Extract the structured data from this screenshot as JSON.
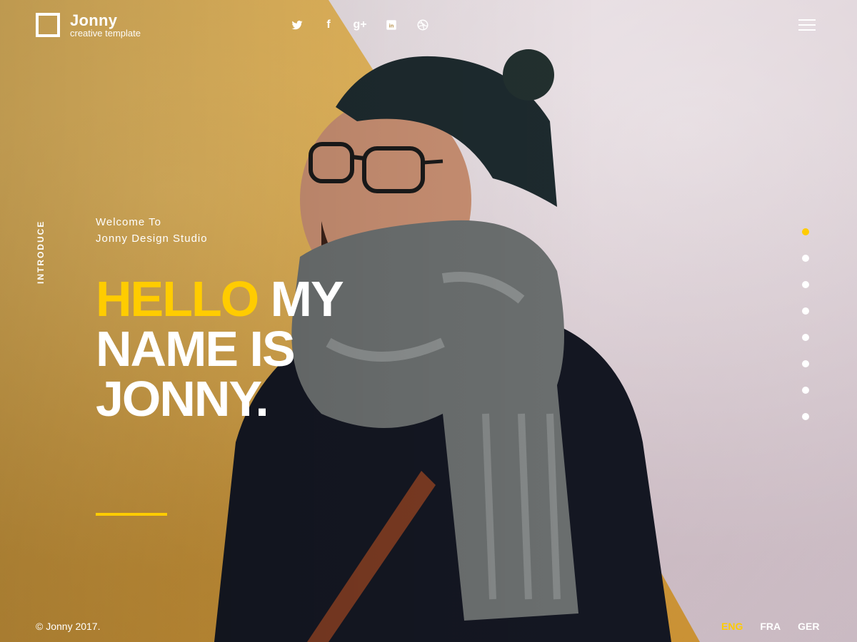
{
  "brand": {
    "name": "Jonny",
    "tagline": "creative template"
  },
  "social": [
    {
      "name": "twitter-icon"
    },
    {
      "name": "facebook-icon",
      "glyph": "f"
    },
    {
      "name": "google-plus-icon",
      "glyph": "g+"
    },
    {
      "name": "linkedin-icon",
      "glyph": "in"
    },
    {
      "name": "dribbble-icon"
    }
  ],
  "menu": {
    "icon": "hamburger-menu-icon"
  },
  "side_label": "INTRODUCE",
  "intro": {
    "welcome_line1": "Welcome To",
    "welcome_line2": "Jonny Design Studio",
    "headline_accent": "HELLO",
    "headline_rest1": " MY",
    "headline_line2": "NAME IS",
    "headline_line3": "JONNY."
  },
  "slides": {
    "count": 8,
    "active_index": 0
  },
  "footer": {
    "copyright": "© Jonny 2017."
  },
  "languages": [
    "ENG",
    "FRA",
    "GER"
  ],
  "active_language": "ENG",
  "colors": {
    "accent": "#ffcc00",
    "text": "#ffffff",
    "wall_left": "#d9a546",
    "wall_right": "#e9dfe2"
  }
}
